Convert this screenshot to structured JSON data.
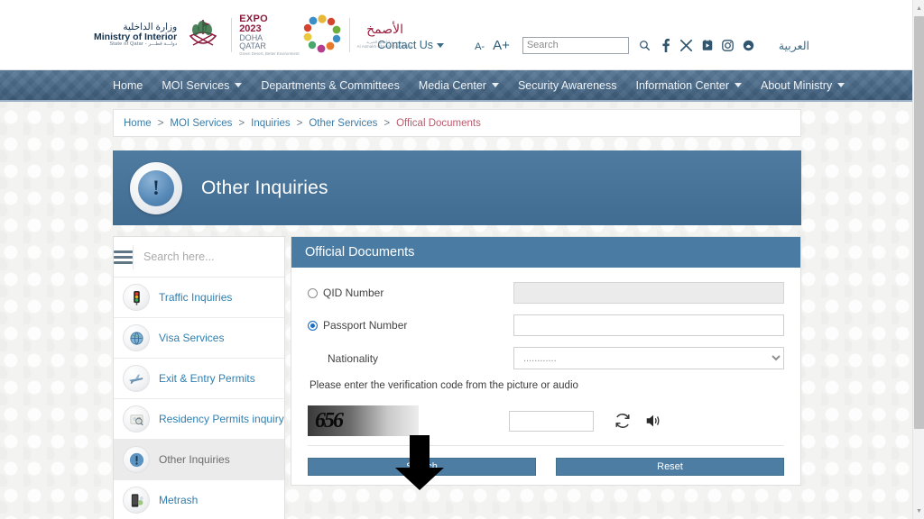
{
  "header": {
    "logo_moi": {
      "arabic": "وزارة الداخلية",
      "english": "Ministry of Interior",
      "subtitle": "State of Qatar - دولـــة قطـــر"
    },
    "logo_expo": {
      "line1": "EXPO",
      "line2": "2023",
      "line3": "DOHA",
      "line4": "QATAR",
      "line5": "Green Desert, Better Environment"
    },
    "logo_partner": {
      "arabic": "الأصمخ",
      "line1": "مؤسسة الأصمخ الخيرية",
      "line2": "Al Asmakh Charity Foundation"
    },
    "contact_us": "Contact Us",
    "font_decrease": "A-",
    "font_increase": "A+",
    "search_placeholder": "Search",
    "search_value": "",
    "socials": [
      {
        "name": "search-icon",
        "glyph": "search"
      },
      {
        "name": "facebook-icon",
        "glyph": "f"
      },
      {
        "name": "x-twitter-icon",
        "glyph": "X"
      },
      {
        "name": "youtube-icon",
        "glyph": "youtube"
      },
      {
        "name": "instagram-icon",
        "glyph": "instagram"
      },
      {
        "name": "snapchat-icon",
        "glyph": "snapchat"
      }
    ],
    "arabic_link": "العربية"
  },
  "nav": {
    "items": [
      {
        "label": "Home",
        "has_caret": false
      },
      {
        "label": "MOI Services",
        "has_caret": true
      },
      {
        "label": "Departments & Committees",
        "has_caret": false
      },
      {
        "label": "Media Center",
        "has_caret": true
      },
      {
        "label": "Security Awareness",
        "has_caret": false
      },
      {
        "label": "Information Center",
        "has_caret": true
      },
      {
        "label": "About Ministry",
        "has_caret": true
      }
    ]
  },
  "breadcrumb": {
    "items": [
      "Home",
      "MOI Services",
      "Inquiries",
      "Other Services",
      "Offical Documents"
    ],
    "separator": ">"
  },
  "banner": {
    "title": "Other Inquiries",
    "icon": "exclamation-icon",
    "icon_glyph": "!",
    "background_color": "#45739b"
  },
  "sidebar": {
    "search_placeholder": "Search here...",
    "search_value": "",
    "items": [
      {
        "label": "Traffic Inquiries",
        "icon": "traffic-light-icon",
        "glyph": "🚦",
        "active": false
      },
      {
        "label": "Visa Services",
        "icon": "visa-globe-icon",
        "glyph": "🌐",
        "active": false
      },
      {
        "label": "Exit & Entry Permits",
        "icon": "airplane-icon",
        "glyph": "✈",
        "active": false
      },
      {
        "label": "Residency Permits inquiry",
        "icon": "residency-icon",
        "glyph": "🔎",
        "active": false
      },
      {
        "label": "Other Inquiries",
        "icon": "exclamation-icon",
        "glyph": "!",
        "active": true
      },
      {
        "label": "Metrash",
        "icon": "mobile-phone-icon",
        "glyph": "📱",
        "active": false
      }
    ]
  },
  "panel": {
    "title": "Official Documents",
    "header_color": "#4a7ba3",
    "fields": {
      "qid": {
        "label": "QID Number",
        "selected": false,
        "value": "",
        "disabled": true
      },
      "passport": {
        "label": "Passport Number",
        "selected": true,
        "value": "",
        "disabled": false
      },
      "nationality": {
        "label": "Nationality",
        "value": "............",
        "options": [
          "............"
        ]
      }
    },
    "captcha": {
      "hint": "Please enter the verification code from the picture or audio",
      "image_text": "656",
      "input_value": "",
      "refresh_icon": "refresh-icon",
      "audio_icon": "speaker-icon"
    },
    "buttons": {
      "search": "Search",
      "reset": "Reset"
    }
  },
  "annotation": {
    "arrow": "down-arrow-annotation",
    "color": "#000000",
    "points_at": "Search"
  },
  "scrollbar": {
    "up_glyph": "▲",
    "down_glyph": "▼",
    "position_percent": 3
  }
}
